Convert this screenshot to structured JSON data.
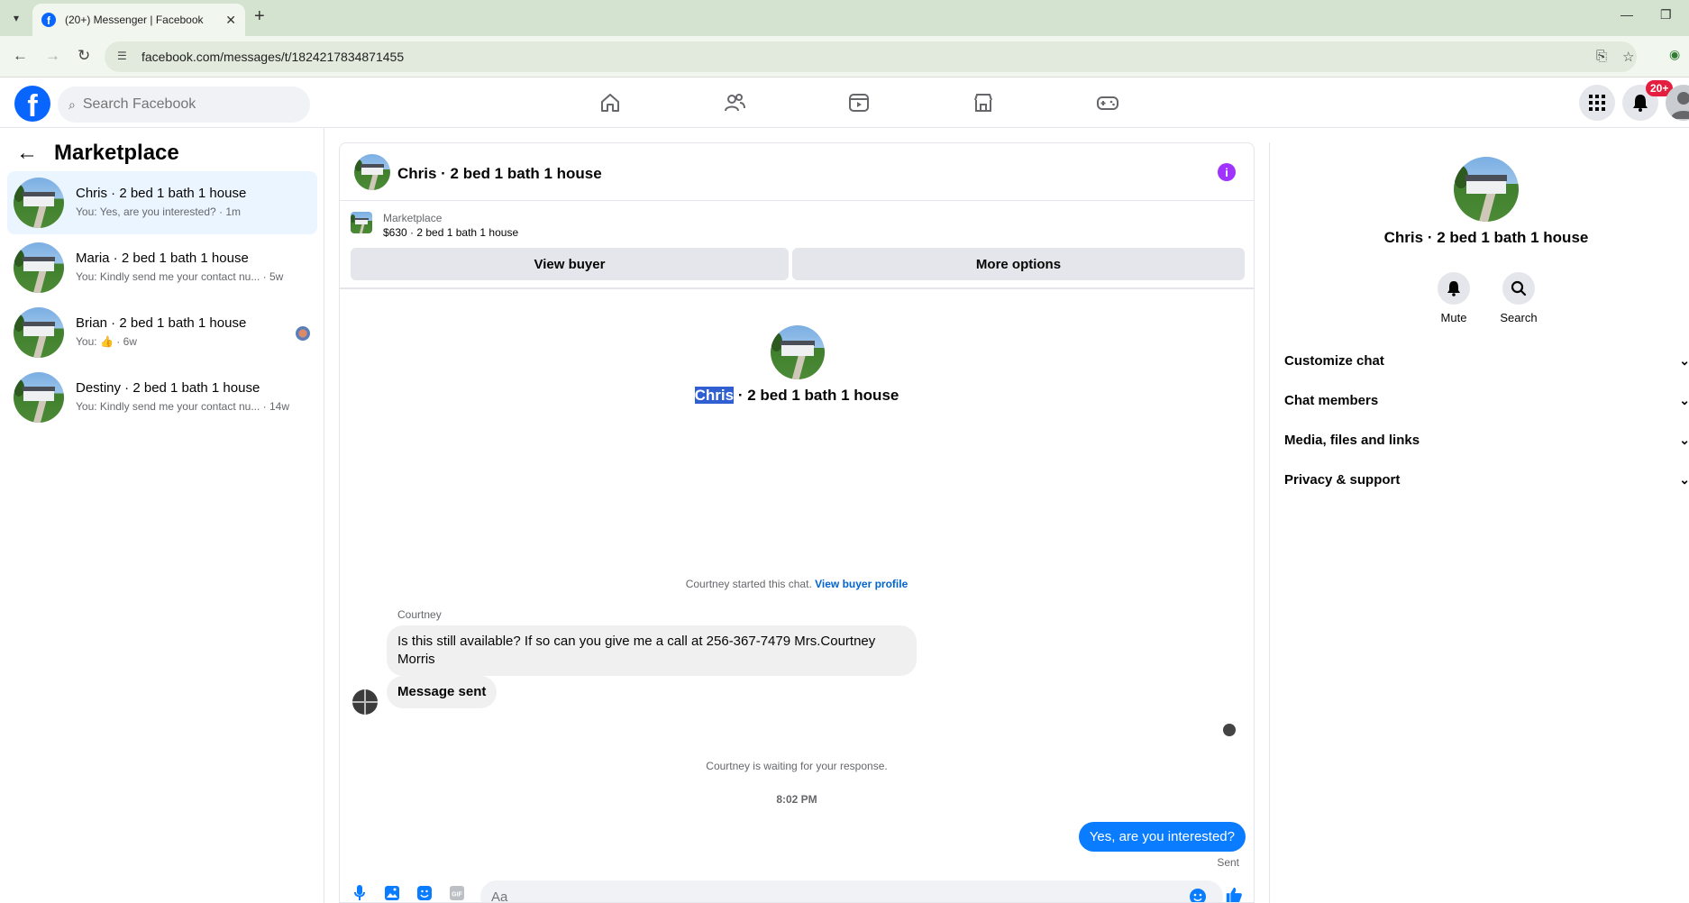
{
  "browser": {
    "tab_title": "(20+) Messenger | Facebook",
    "url": "facebook.com/messages/t/1824217834871455"
  },
  "header": {
    "search_placeholder": "Search Facebook",
    "notification_badge": "20+",
    "brand_color": "#0866ff"
  },
  "sidebar": {
    "title": "Marketplace",
    "conversations": [
      {
        "name": "Chris · 2 bed 1 bath 1 house",
        "preview": "You: Yes, are you interested? · 1m",
        "active": true
      },
      {
        "name": "Maria · 2 bed 1 bath 1 house",
        "preview": "You: Kindly send me your contact nu... · 5w"
      },
      {
        "name": "Brian · 2 bed 1 bath 1 house",
        "preview_prefix": "You:",
        "preview_suffix": "· 6w"
      },
      {
        "name": "Destiny · 2 bed 1 bath 1 house",
        "preview": "You: Kindly send me your contact nu... · 14w"
      }
    ]
  },
  "chat": {
    "title": "Chris · 2 bed 1 bath 1 house",
    "listing_source": "Marketplace",
    "listing_summary": "$630 · 2 bed 1 bath 1 house",
    "view_buyer_label": "View buyer",
    "more_options_label": "More options",
    "hero_highlight": "Chris",
    "hero_rest": " · 2 bed 1 bath 1 house",
    "started_text": "Courtney started this chat.",
    "started_link": "View buyer profile",
    "sender_name": "Courtney",
    "message_1": "Is this still available? If so can you give me a call at 256-367-7479 Mrs.Courtney Morris",
    "message_2": "Message sent",
    "waiting_text": "Courtney is waiting for your response.",
    "timestamp": "8:02 PM",
    "outgoing": "Yes, are you interested?",
    "status": "Sent",
    "composer_placeholder": "Aa",
    "outgoing_color": "#0a7cff"
  },
  "details": {
    "name": "Chris · 2 bed 1 bath 1 house",
    "mute_label": "Mute",
    "search_label": "Search",
    "sections": [
      "Customize chat",
      "Chat members",
      "Media, files and links",
      "Privacy & support"
    ]
  }
}
